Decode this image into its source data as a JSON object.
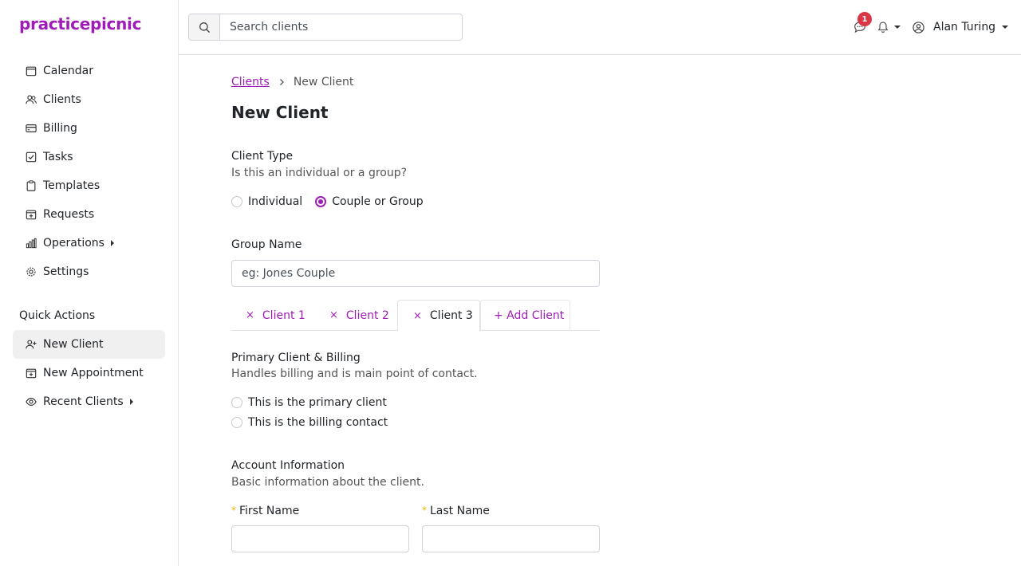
{
  "app": {
    "logo": "practicepicnic",
    "accent": "#a01cb8"
  },
  "sidebar": {
    "items": [
      {
        "label": "Calendar",
        "icon": "calendar-icon"
      },
      {
        "label": "Clients",
        "icon": "users-icon"
      },
      {
        "label": "Billing",
        "icon": "credit-card-icon"
      },
      {
        "label": "Tasks",
        "icon": "checkbox-icon"
      },
      {
        "label": "Templates",
        "icon": "clipboard-icon"
      },
      {
        "label": "Requests",
        "icon": "calendar-plus-icon"
      },
      {
        "label": "Operations",
        "icon": "bar-chart-icon"
      },
      {
        "label": "Settings",
        "icon": "gear-icon"
      }
    ],
    "quick_actions_title": "Quick Actions",
    "quick_actions": [
      {
        "label": "New Client",
        "icon": "user-plus-icon"
      },
      {
        "label": "New Appointment",
        "icon": "calendar-plus-icon"
      },
      {
        "label": "Recent Clients",
        "icon": "eye-icon"
      }
    ]
  },
  "topbar": {
    "search_placeholder": "Search clients",
    "messages_count": "1",
    "user_name": "Alan Turing"
  },
  "breadcrumb": {
    "parent": "Clients",
    "current": "New Client"
  },
  "page_title": "New Client",
  "client_type": {
    "title": "Client Type",
    "subtitle": "Is this an individual or a group?",
    "options": [
      "Individual",
      "Couple or Group"
    ],
    "selected": "Couple or Group"
  },
  "group_name": {
    "label": "Group Name",
    "placeholder": "eg: Jones Couple"
  },
  "tabs": {
    "client1": "Client 1",
    "client2": "Client 2",
    "client3": "Client 3",
    "add": "+ Add Client",
    "close_glyph": "×"
  },
  "primary": {
    "title": "Primary Client & Billing",
    "subtitle": "Handles billing and is main point of contact.",
    "option_primary": "This is the primary client",
    "option_billing": "This is the billing contact"
  },
  "account": {
    "title": "Account Information",
    "subtitle": "Basic information about the client.",
    "first_name_label": "First Name",
    "last_name_label": "Last Name",
    "required_mark": "*"
  }
}
